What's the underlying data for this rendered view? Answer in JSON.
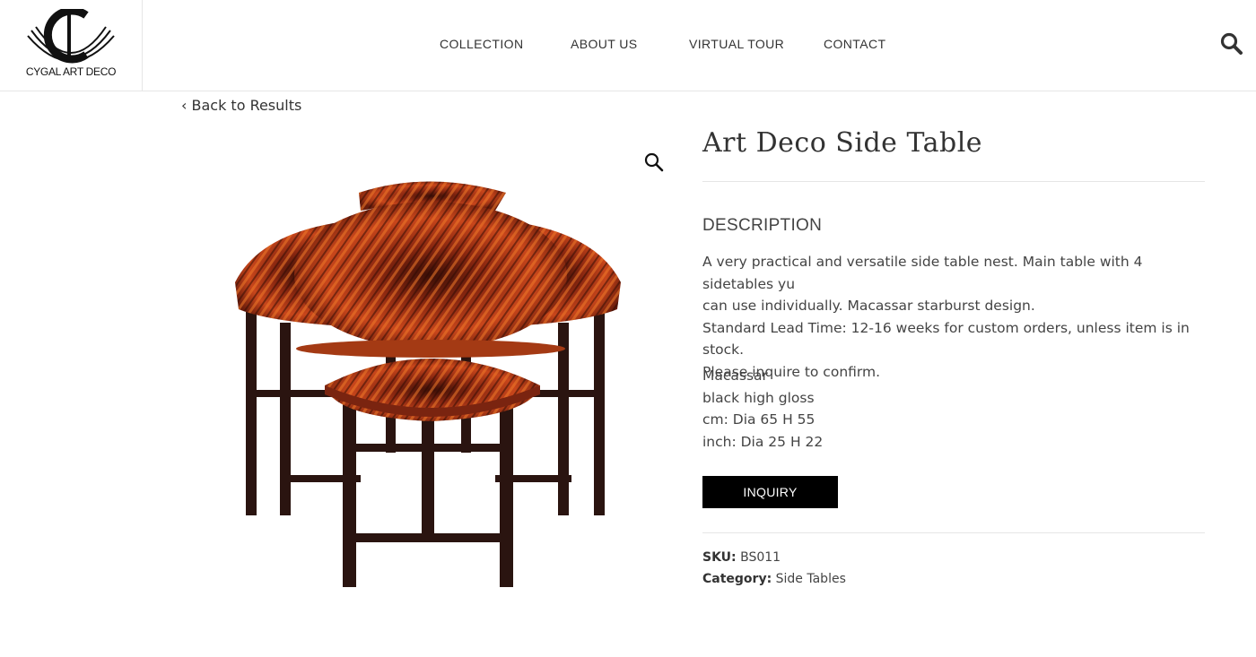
{
  "brand": {
    "logo_text": "CYGAL ART DECO"
  },
  "nav": {
    "items": [
      "COLLECTION",
      "ABOUT US",
      "VIRTUAL TOUR",
      "CONTACT"
    ]
  },
  "back_link": "‹ Back to Results",
  "product": {
    "title": "Art Deco Side Table",
    "description_heading": "DESCRIPTION",
    "description_lines": [
      "A very practical and versatile side table nest. Main table with 4 sidetables yu",
      "can use individually. Macassar starburst design.",
      "Standard Lead Time: 12-16 weeks for custom orders, unless item is in stock.",
      "Please inquire to confirm."
    ],
    "specs": [
      "Macassar",
      "black high gloss",
      "cm: Dia 65 H 55",
      "inch: Dia 25 H 22"
    ],
    "inquiry_label": "INQUIRY",
    "sku_label": "SKU:",
    "sku_value": "BS011",
    "category_label": "Category:",
    "category_value": "Side Tables"
  },
  "icons": {
    "header_search": "search-icon",
    "image_zoom": "zoom-magnifier-icon"
  },
  "colors": {
    "button_bg": "#000000",
    "button_text": "#ffffff",
    "text": "#444444",
    "divider": "#e6e6e6",
    "wood_dark": "#5a1a0c",
    "wood_orange": "#e2551b",
    "legs": "#2a1410"
  }
}
